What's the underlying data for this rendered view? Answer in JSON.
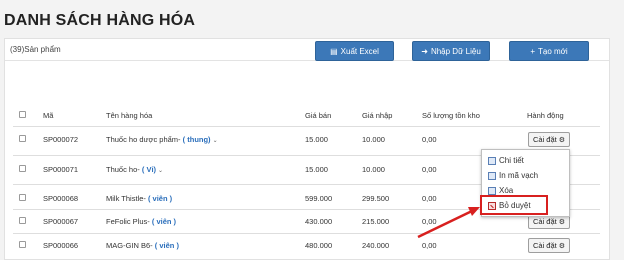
{
  "page_title": "DANH SÁCH HÀNG HÓA",
  "panel": {
    "count_label": "(39)Sản phẩm"
  },
  "toolbar": {
    "export_label": "Xuất Excel",
    "import_label": "Nhập Dữ Liệu",
    "create_label": "Tạo mới"
  },
  "table": {
    "headers": [
      "Mã",
      "Tên hàng hóa",
      "Giá bán",
      "Giá nhập",
      "Số lượng tồn kho",
      "Hành động"
    ],
    "rows": [
      {
        "code": "SP000072",
        "name": "Thuốc ho dược phẩm-",
        "unit": "( thung)",
        "price": "15.000",
        "cost": "10.000",
        "stock": "0,00",
        "action": "Cài đặt"
      },
      {
        "code": "SP000071",
        "name": "Thuốc ho-",
        "unit": "( Vỉ)",
        "price": "15.000",
        "cost": "10.000",
        "stock": "0,00",
        "action": ""
      },
      {
        "code": "SP000068",
        "name": "Milk Thistle-",
        "unit": "( viên )",
        "price": "599.000",
        "cost": "299.500",
        "stock": "0,00",
        "action": ""
      },
      {
        "code": "SP000067",
        "name": "FeFolic Plus-",
        "unit": "( viên )",
        "price": "430.000",
        "cost": "215.000",
        "stock": "0,00",
        "action": "Cài đặt"
      },
      {
        "code": "SP000066",
        "name": "MAG-GIN B6-",
        "unit": "( viên )",
        "price": "480.000",
        "cost": "240.000",
        "stock": "0,00",
        "action": "Cài đặt"
      }
    ]
  },
  "dropdown": {
    "items": [
      "Chi tiết",
      "In mã vạch",
      "Xóa",
      "Bỏ duyệt"
    ]
  },
  "icons": [
    "checkbox-icon",
    "gear-icon",
    "chevron-down-icon",
    "file-icon",
    "upload-icon",
    "plus-icon",
    "edit-icon",
    "barcode-icon",
    "trash-icon",
    "cancel-icon"
  ],
  "colors": {
    "primary": "#3c78b8",
    "link": "#2a6ebb",
    "highlight": "#d8201f"
  }
}
